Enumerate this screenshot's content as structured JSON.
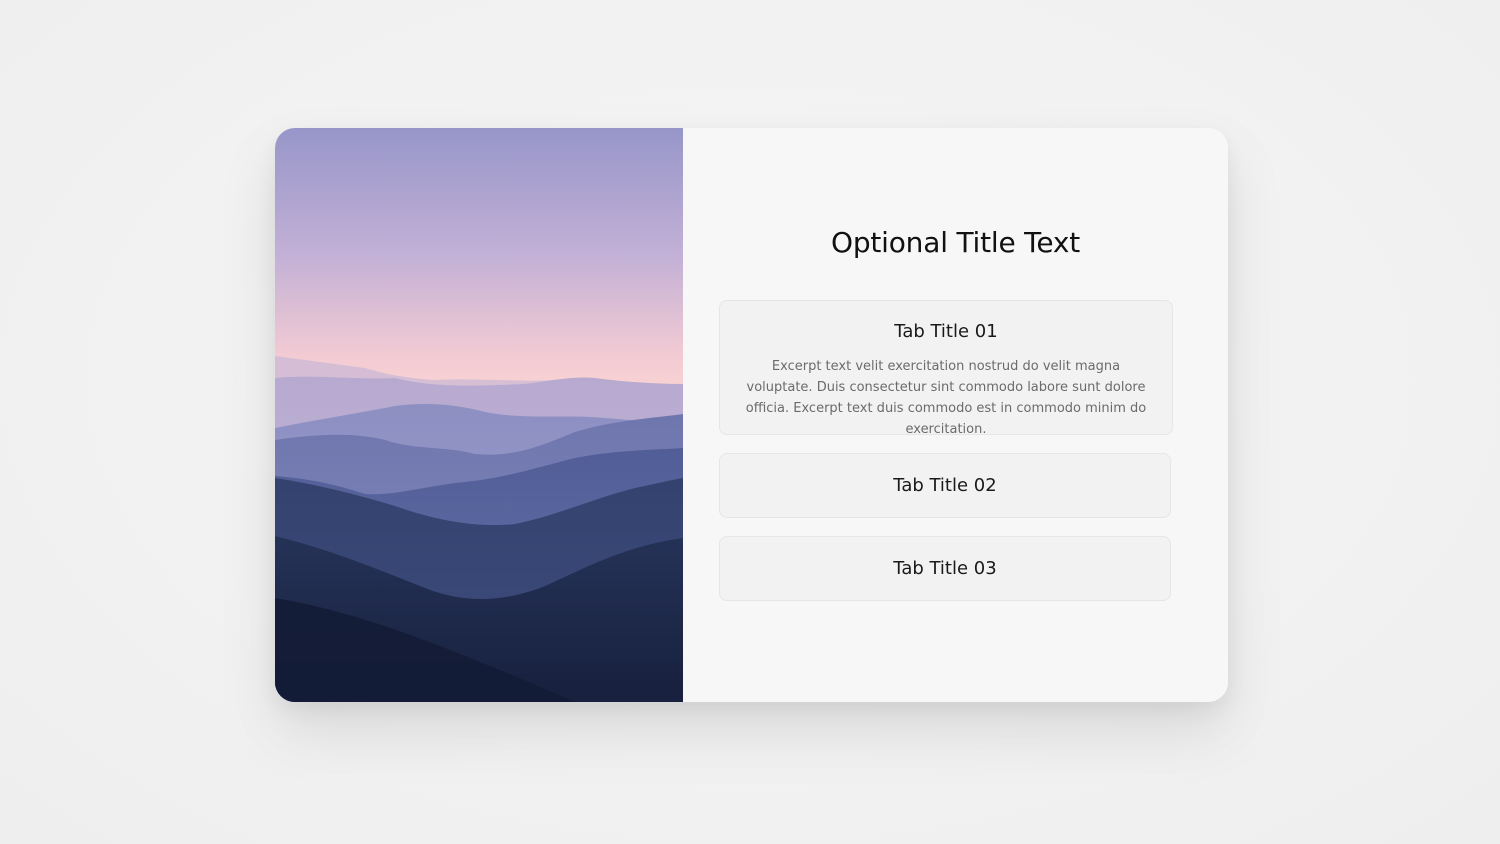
{
  "hero_image": {
    "icon": "mountain-landscape-image",
    "colors": {
      "sky_top": "#9a98cb",
      "sky_mid": "#d9b8d2",
      "sky_horizon": "#fbd8d2",
      "far_ridge": "#a8a6cf",
      "mid_ridge": "#7e82b8",
      "near_ridge": "#4f5b93",
      "foreground": "#1e2a4d"
    }
  },
  "content": {
    "title": "Optional Title Text",
    "tabs": [
      {
        "title": "Tab Title 01",
        "excerpt": "Excerpt text velit exercitation nostrud do velit magna voluptate. Duis consectetur sint commodo labore sunt dolore officia. Excerpt text duis commodo est in commodo minim do exercitation.",
        "expanded": true
      },
      {
        "title": "Tab Title 02",
        "expanded": false
      },
      {
        "title": "Tab Title 03",
        "expanded": false
      }
    ]
  }
}
